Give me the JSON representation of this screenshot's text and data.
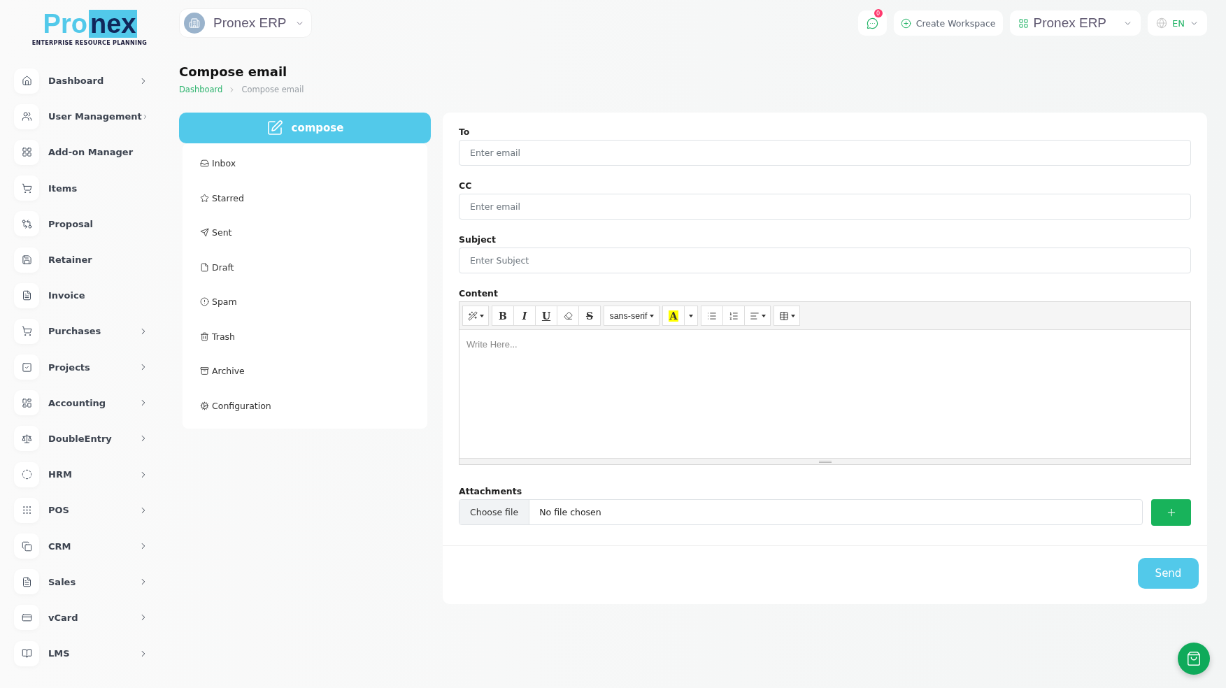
{
  "logo": {
    "wordmark": [
      "Pro",
      "nex"
    ],
    "tagline": "ENTERPRISE RESOURCE PLANNING"
  },
  "workspace_switcher": {
    "label": "Pronex ERP"
  },
  "header": {
    "notifications": {
      "count": "0"
    },
    "create_workspace": "Create Workspace",
    "workspace": "Pronex ERP",
    "language": "EN"
  },
  "sidebar": {
    "items": [
      {
        "label": "Dashboard",
        "expandable": true
      },
      {
        "label": "User Management",
        "expandable": true
      },
      {
        "label": "Add-on Manager",
        "expandable": false
      },
      {
        "label": "Items",
        "expandable": false
      },
      {
        "label": "Proposal",
        "expandable": false
      },
      {
        "label": "Retainer",
        "expandable": false
      },
      {
        "label": "Invoice",
        "expandable": false
      },
      {
        "label": "Purchases",
        "expandable": true
      },
      {
        "label": "Projects",
        "expandable": true
      },
      {
        "label": "Accounting",
        "expandable": true
      },
      {
        "label": "DoubleEntry",
        "expandable": true
      },
      {
        "label": "HRM",
        "expandable": true
      },
      {
        "label": "POS",
        "expandable": true
      },
      {
        "label": "CRM",
        "expandable": true
      },
      {
        "label": "Sales",
        "expandable": true
      },
      {
        "label": "vCard",
        "expandable": true
      },
      {
        "label": "LMS",
        "expandable": true
      }
    ]
  },
  "page": {
    "title": "Compose email",
    "breadcrumb": [
      "Dashboard",
      "Compose email"
    ]
  },
  "mail_menu": {
    "compose": "compose",
    "items": [
      {
        "label": "Inbox"
      },
      {
        "label": "Starred"
      },
      {
        "label": "Sent"
      },
      {
        "label": "Draft"
      },
      {
        "label": "Spam"
      },
      {
        "label": "Trash"
      },
      {
        "label": "Archive"
      },
      {
        "label": "Configuration"
      }
    ]
  },
  "form": {
    "fields": [
      {
        "label": "To",
        "placeholder": "Enter email"
      },
      {
        "label": "CC",
        "placeholder": "Enter email"
      },
      {
        "label": "Subject",
        "placeholder": "Enter Subject"
      }
    ],
    "content": {
      "label": "Content",
      "placeholder": "Write Here...",
      "toolbar": [
        [
          {
            "kind": "magic"
          }
        ],
        [
          {
            "kind": "bold",
            "label": "B"
          },
          {
            "kind": "italic",
            "label": "I"
          },
          {
            "kind": "underline",
            "label": "U"
          },
          {
            "kind": "eraser"
          },
          {
            "kind": "strike",
            "label": "S"
          }
        ],
        [
          {
            "kind": "font",
            "label": "sans-serif"
          }
        ],
        [
          {
            "kind": "color",
            "label": "A"
          },
          {
            "kind": "caret"
          }
        ],
        [
          {
            "kind": "ul"
          },
          {
            "kind": "ol"
          },
          {
            "kind": "align"
          }
        ],
        [
          {
            "kind": "table"
          }
        ]
      ]
    },
    "attachments": {
      "label": "Attachments",
      "button": "Choose file",
      "status": "No file chosen"
    },
    "send": "Send"
  }
}
